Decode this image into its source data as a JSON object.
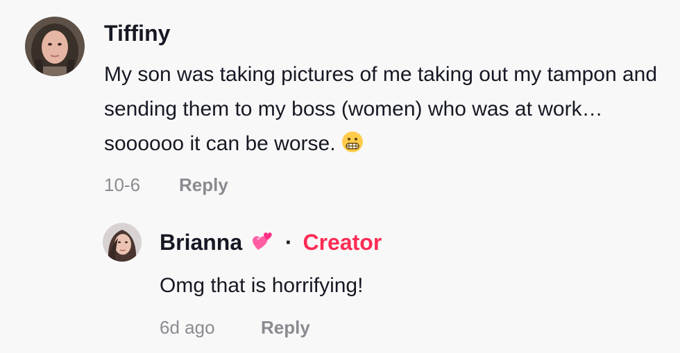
{
  "comments": {
    "main": {
      "username": "Tiffiny",
      "text": "My son was taking pictures of me taking out my tampon and sending them to my boss (women) who was at work… soooooo it can be worse.",
      "text_emoji": "grimacing-face",
      "date": "10-6",
      "reply_label": "Reply"
    },
    "reply": {
      "username": "Brianna",
      "name_emoji": "two-hearts",
      "separator": "·",
      "badge": "Creator",
      "text": "Omg that is horrifying!",
      "date": "6d ago",
      "reply_label": "Reply"
    }
  },
  "colors": {
    "background": "#f8f8f8",
    "text": "#161823",
    "muted": "#8a8b91",
    "creator": "#fe2c55"
  }
}
